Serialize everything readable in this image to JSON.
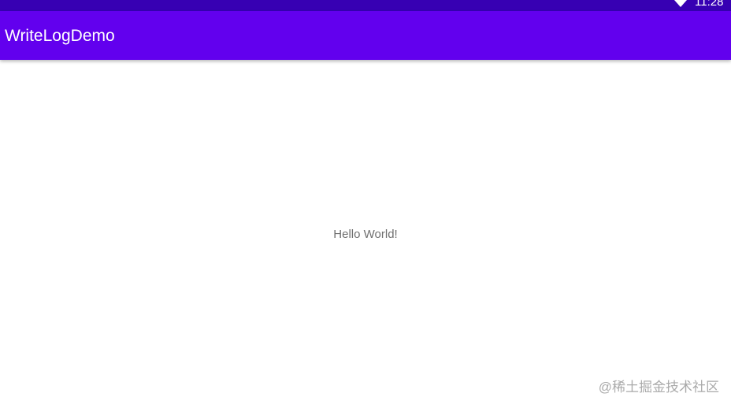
{
  "status_bar": {
    "time": "11:28",
    "wifi_icon": "wifi-icon"
  },
  "app_bar": {
    "title": "WriteLogDemo"
  },
  "main": {
    "text": "Hello World!"
  },
  "watermark": {
    "text": "@稀土掘金技术社区"
  },
  "colors": {
    "status_bar": "#3700b3",
    "app_bar": "#6200ee",
    "background": "#ffffff",
    "body_text": "#6f6f6f"
  }
}
